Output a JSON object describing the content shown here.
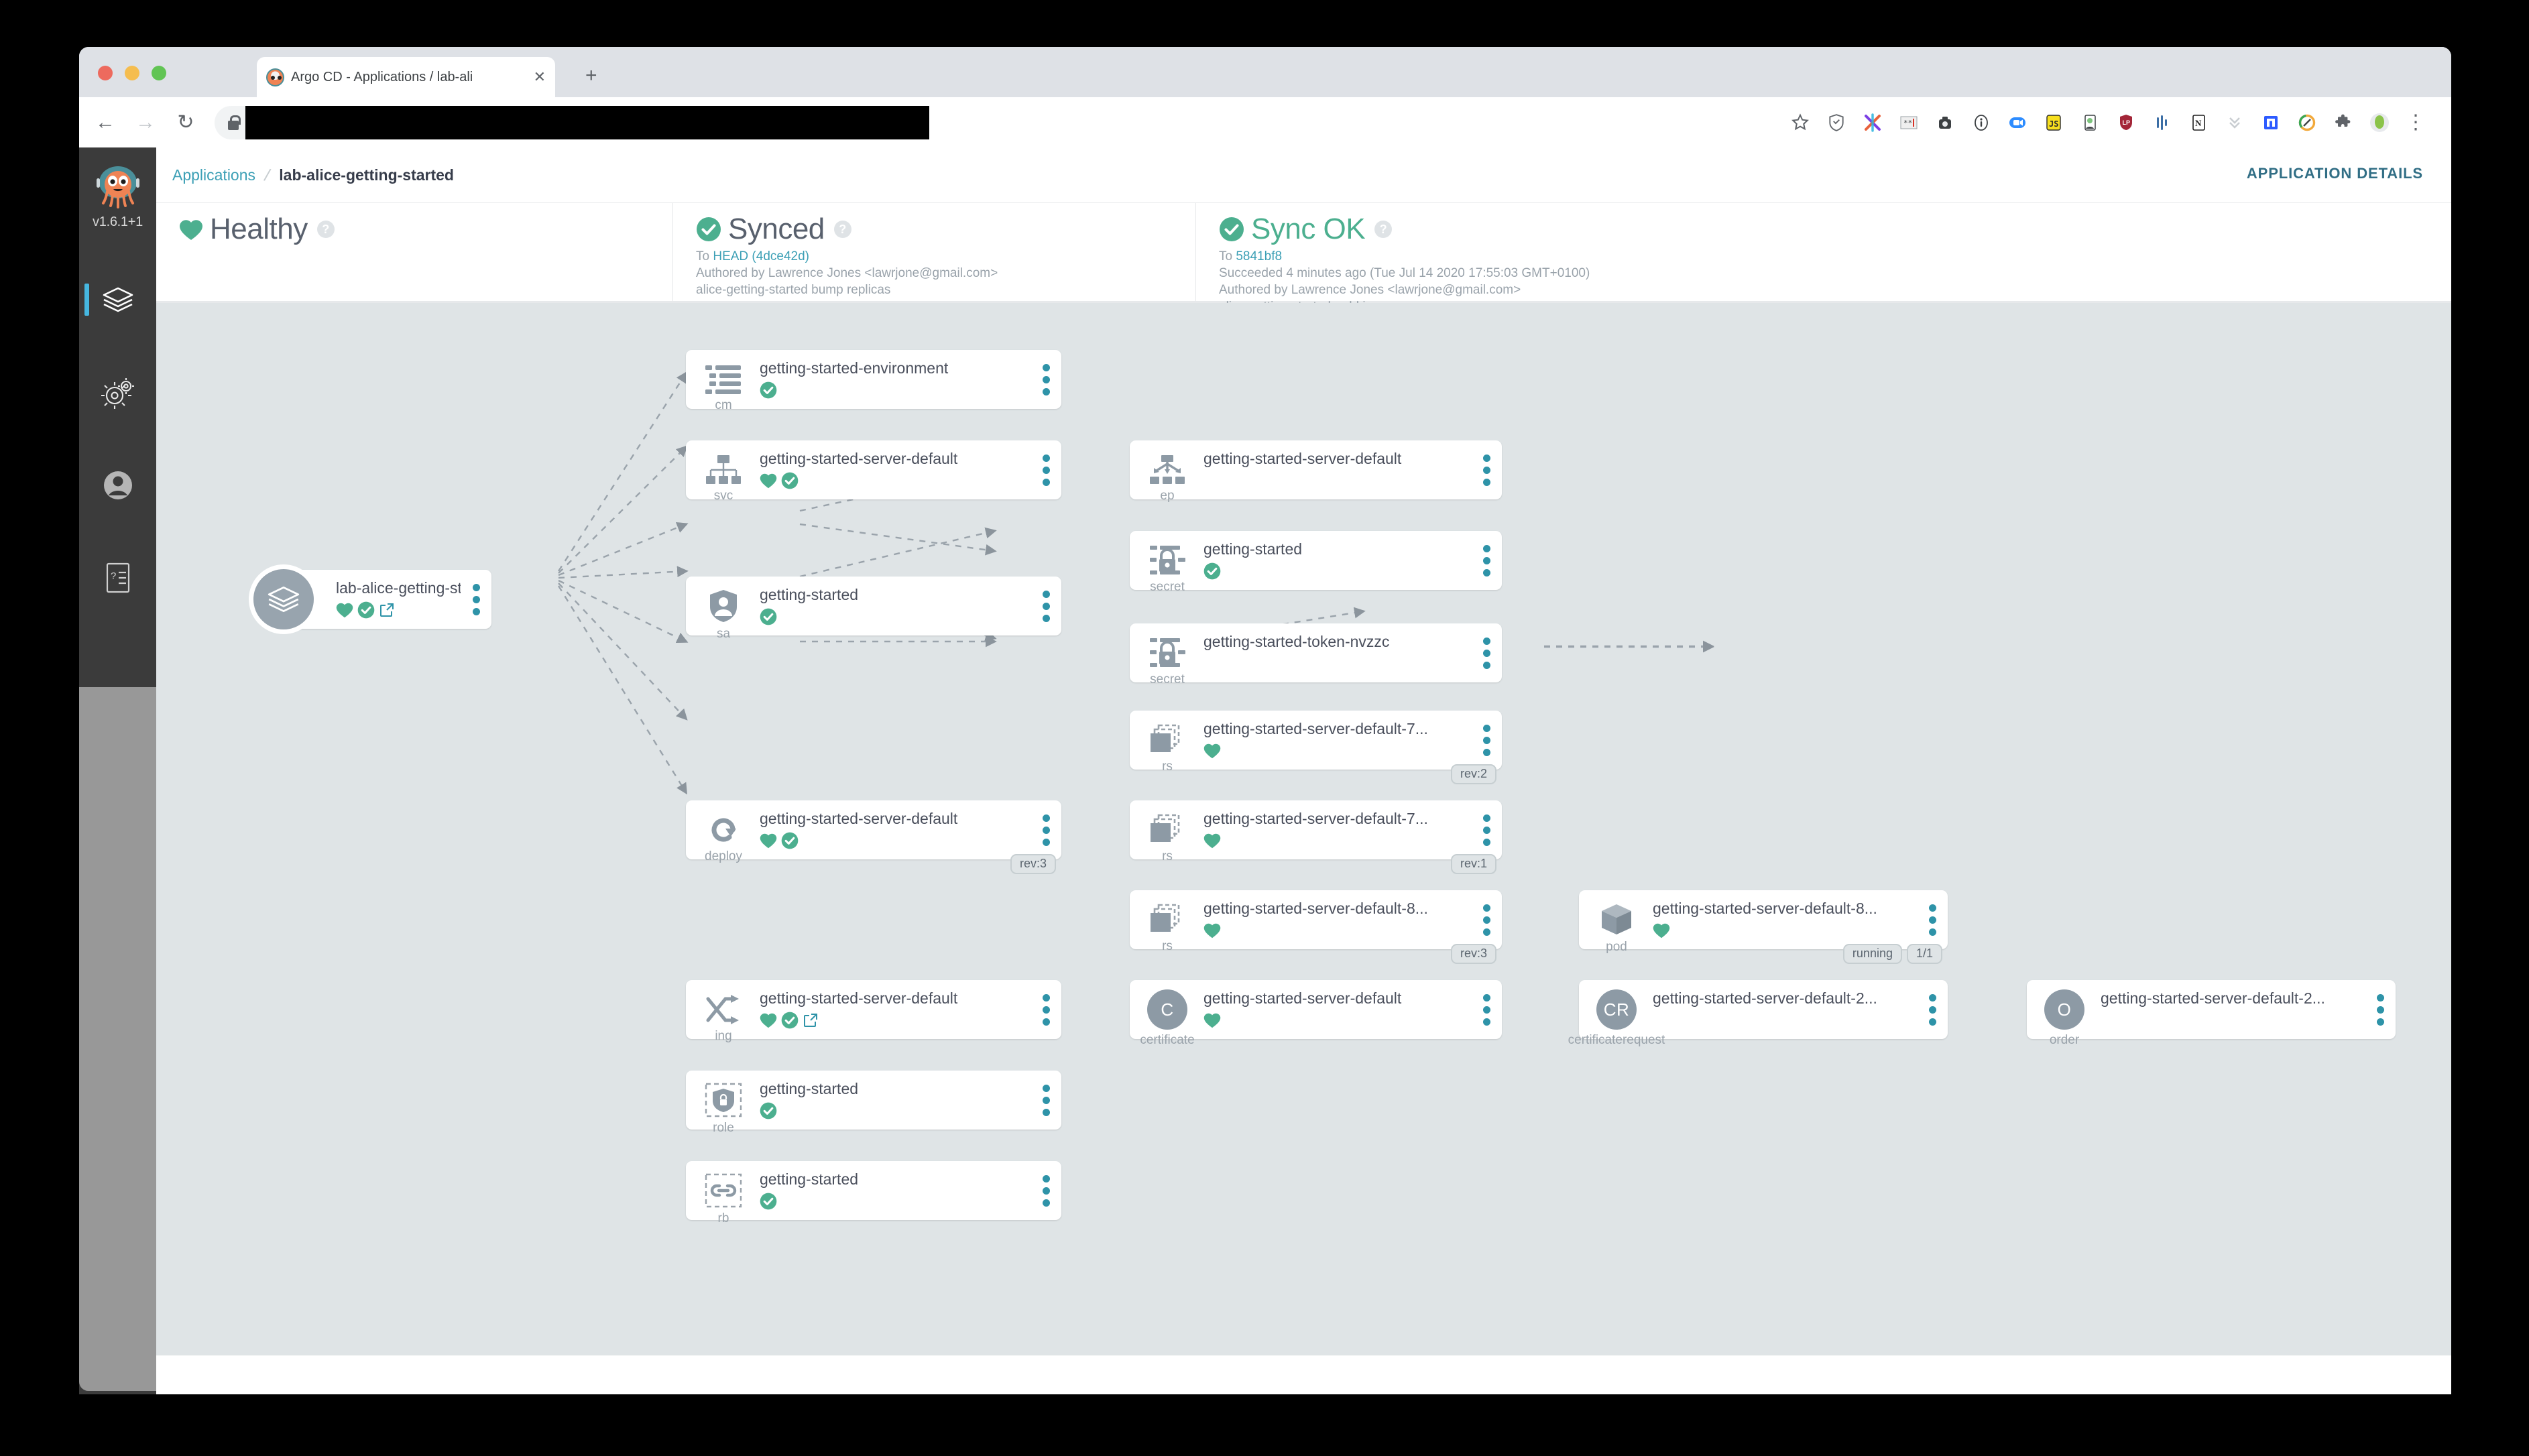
{
  "browser": {
    "tab_title": "Argo CD - Applications / lab-ali",
    "tab_close": "✕",
    "new_tab": "+",
    "back_icon": "←",
    "forward_icon": "→",
    "reload_icon": "↻",
    "menu_icon": "⋮",
    "url_value": ""
  },
  "sidebar": {
    "version": "v1.6.1+1",
    "items": [
      {
        "name": "applications",
        "active": true
      },
      {
        "name": "settings",
        "active": false
      },
      {
        "name": "user-info",
        "active": false
      },
      {
        "name": "documentation",
        "active": false
      }
    ]
  },
  "header": {
    "breadcrumb_root": "Applications",
    "breadcrumb_separator": "/",
    "breadcrumb_current": "lab-alice-getting-started",
    "application_details": "APPLICATION DETAILS"
  },
  "status": {
    "health": {
      "label": "Healthy",
      "help": "?"
    },
    "sync": {
      "label": "Synced",
      "help": "?",
      "line1_prefix": "To ",
      "line1_link": "HEAD (4dce42d)",
      "line2": "Authored by Lawrence Jones <lawrjone@gmail.com>",
      "line3": "alice-getting-started bump replicas"
    },
    "operation": {
      "label": "Sync OK",
      "help": "?",
      "line1_prefix": "To ",
      "line1_link": "5841bf8",
      "line2": "Succeeded 4 minutes ago (Tue Jul 14 2020 17:55:03 GMT+0100)",
      "line3": "Authored by Lawrence Jones <lawrjone@gmail.com>",
      "line4": "alice-getting-started: add ingress"
    }
  },
  "colors": {
    "healthy_green": "#4caf8f",
    "link_teal": "#3b9fb5",
    "kebab_teal": "#2e93a8",
    "canvas_bg": "#dfe4e6",
    "node_icon_grey": "#8d9aa5"
  },
  "graph": {
    "nodes": [
      {
        "id": "app-root",
        "kind": "",
        "kind_label": "",
        "name": "lab-alice-getting-started",
        "icon": "layers-icon",
        "badges": [
          "healthy-heart",
          "synced-tick",
          "external-link"
        ],
        "pills": []
      },
      {
        "id": "cm",
        "kind_label": "cm",
        "name": "getting-started-environment",
        "icon": "configmap-icon",
        "badges": [
          "synced-tick"
        ],
        "pills": []
      },
      {
        "id": "svc",
        "kind_label": "svc",
        "name": "getting-started-server-default",
        "icon": "service-icon",
        "badges": [
          "healthy-heart",
          "synced-tick"
        ],
        "pills": []
      },
      {
        "id": "sa",
        "kind_label": "sa",
        "name": "getting-started",
        "icon": "serviceaccount-icon",
        "badges": [
          "synced-tick"
        ],
        "pills": []
      },
      {
        "id": "deploy",
        "kind_label": "deploy",
        "name": "getting-started-server-default",
        "icon": "deployment-icon",
        "badges": [
          "healthy-heart",
          "synced-tick"
        ],
        "pills": [
          "rev:3"
        ]
      },
      {
        "id": "ing",
        "kind_label": "ing",
        "name": "getting-started-server-default",
        "icon": "ingress-icon",
        "badges": [
          "healthy-heart",
          "synced-tick",
          "external-link"
        ],
        "pills": []
      },
      {
        "id": "role",
        "kind_label": "role",
        "name": "getting-started",
        "icon": "role-icon",
        "badges": [
          "synced-tick"
        ],
        "pills": []
      },
      {
        "id": "rb",
        "kind_label": "rb",
        "name": "getting-started",
        "icon": "rolebinding-icon",
        "badges": [
          "synced-tick"
        ],
        "pills": []
      },
      {
        "id": "ep",
        "kind_label": "ep",
        "name": "getting-started-server-default",
        "icon": "endpoints-icon",
        "badges": [],
        "pills": []
      },
      {
        "id": "secret1",
        "kind_label": "secret",
        "name": "getting-started",
        "icon": "secret-icon",
        "badges": [
          "synced-tick"
        ],
        "pills": []
      },
      {
        "id": "secret2",
        "kind_label": "secret",
        "name": "getting-started-token-nvzzc",
        "icon": "secret-icon",
        "badges": [],
        "pills": []
      },
      {
        "id": "rs1",
        "kind_label": "rs",
        "name": "getting-started-server-default-7...",
        "icon": "replicaset-icon",
        "badges": [
          "healthy-heart"
        ],
        "pills": [
          "rev:2"
        ]
      },
      {
        "id": "rs2",
        "kind_label": "rs",
        "name": "getting-started-server-default-7...",
        "icon": "replicaset-icon",
        "badges": [
          "healthy-heart"
        ],
        "pills": [
          "rev:1"
        ]
      },
      {
        "id": "rs3",
        "kind_label": "rs",
        "name": "getting-started-server-default-8...",
        "icon": "replicaset-icon",
        "badges": [
          "healthy-heart"
        ],
        "pills": [
          "rev:3"
        ]
      },
      {
        "id": "certificate",
        "kind_label": "certificate",
        "name": "getting-started-server-default",
        "icon": "certificate-circle-C",
        "badges": [
          "healthy-heart"
        ],
        "pills": []
      },
      {
        "id": "pod",
        "kind_label": "pod",
        "name": "getting-started-server-default-8...",
        "icon": "pod-icon",
        "badges": [
          "healthy-heart"
        ],
        "pills": [
          "running",
          "1/1"
        ]
      },
      {
        "id": "certificaterequest",
        "kind_label": "certificaterequest",
        "name": "getting-started-server-default-2...",
        "icon": "certrequest-circle-CR",
        "badges": [],
        "pills": []
      },
      {
        "id": "order",
        "kind_label": "order",
        "name": "getting-started-server-default-2...",
        "icon": "order-circle-O",
        "badges": [],
        "pills": []
      }
    ],
    "circle_labels": {
      "certificate": "C",
      "certificaterequest": "CR",
      "order": "O"
    }
  }
}
